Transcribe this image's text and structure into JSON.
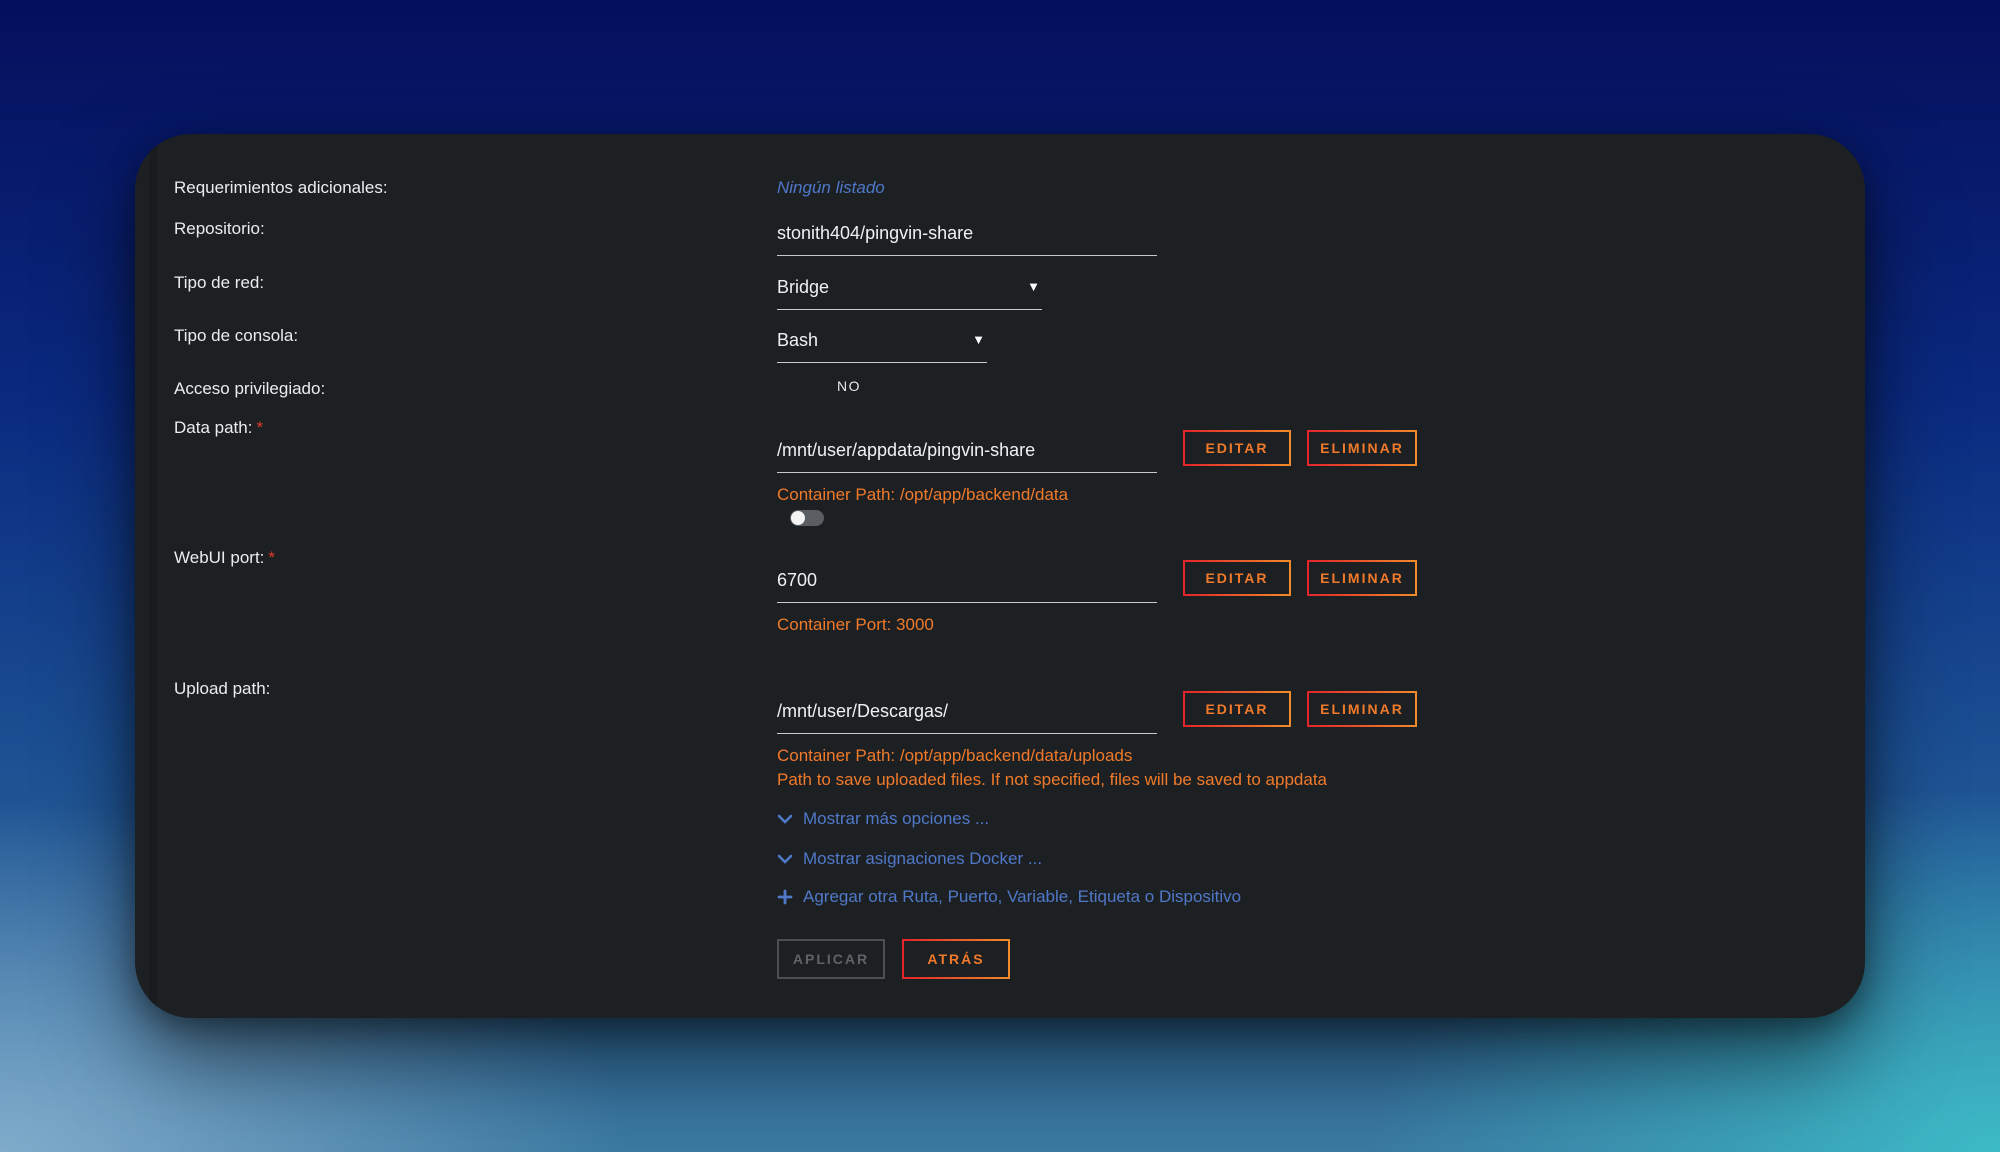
{
  "labels": {
    "additional_requirements": "Requerimientos adicionales:",
    "repository": "Repositorio:",
    "network_type": "Tipo de red:",
    "console_type": "Tipo de consola:",
    "privileged": "Acceso privilegiado:",
    "data_path": "Data path:",
    "webui_port": "WebUI port:",
    "upload_path": "Upload path:",
    "required_marker": "*"
  },
  "values": {
    "additional_requirements": "Ningún listado",
    "repository": "stonith404/pingvin-share",
    "network_type": "Bridge",
    "console_type": "Bash",
    "privileged": "NO",
    "data_path": "/mnt/user/appdata/pingvin-share",
    "webui_port": "6700",
    "upload_path": "/mnt/user/Descargas/"
  },
  "hints": {
    "data_path": "Container Path: /opt/app/backend/data",
    "webui_port": "Container Port: 3000",
    "upload_path": "Container Path: /opt/app/backend/data/uploads",
    "upload_desc": "Path to save uploaded files. If not specified, files will be saved to appdata"
  },
  "buttons": {
    "edit": "EDITAR",
    "delete": "ELIMINAR",
    "apply": "APLICAR",
    "back": "ATRÁS"
  },
  "options": {
    "more_options": "Mostrar más opciones ...",
    "docker_mappings": "Mostrar asignaciones Docker ...",
    "add_other": "Agregar otra Ruta, Puerto, Variable, Etiqueta o Dispositivo"
  },
  "icons": [
    "chevron-down-icon",
    "plus-icon",
    "select-arrow-icon"
  ],
  "colors": {
    "accent": "#f07a2a",
    "link": "#4f78c8",
    "required": "#e03c2c",
    "panel": "#1d2023"
  }
}
